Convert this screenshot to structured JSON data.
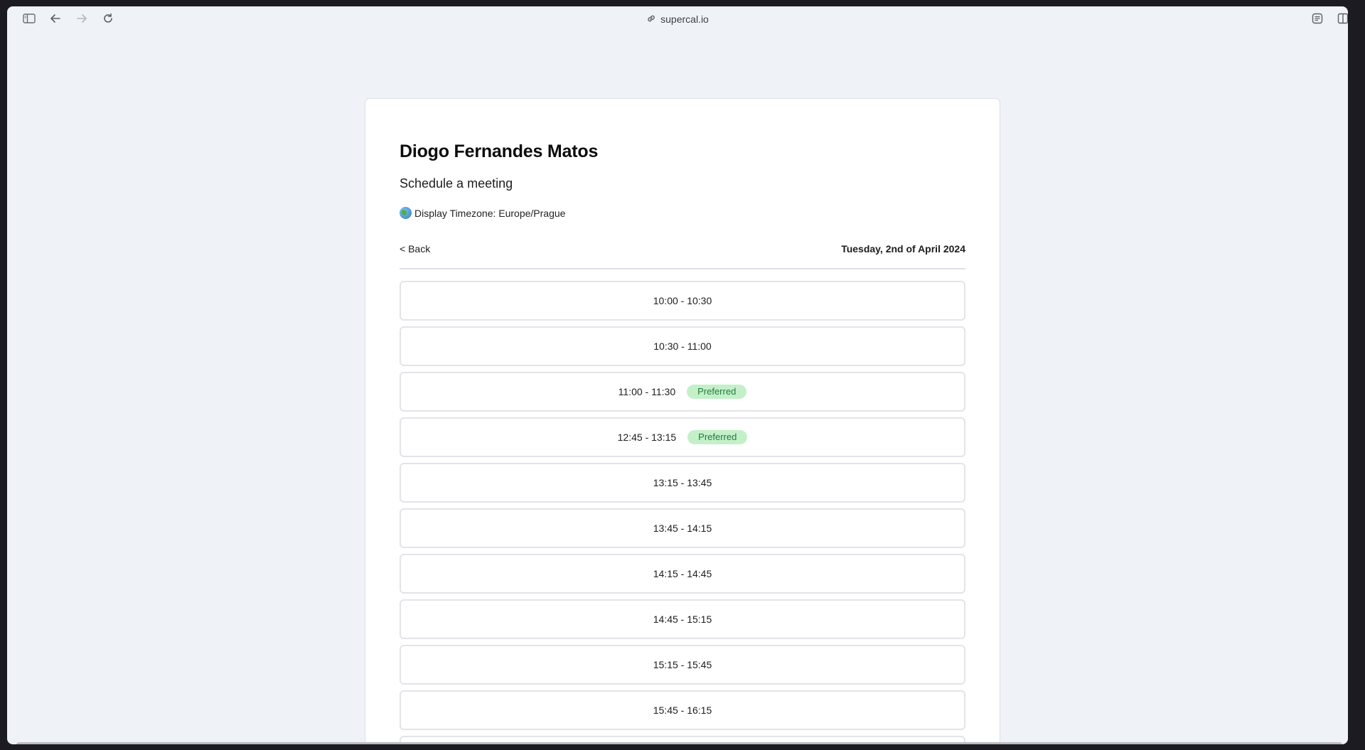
{
  "browser": {
    "url": "supercal.io",
    "icons": {
      "sidebar": "sidebar-toggle-icon",
      "back": "arrow-left-icon",
      "forward": "arrow-right-icon",
      "reload": "reload-icon",
      "link": "link-icon",
      "reader": "reader-mode-icon",
      "split": "split-view-icon"
    }
  },
  "page": {
    "name": "Diogo Fernandes Matos",
    "subtitle": "Schedule a meeting",
    "timezone_label": "Display Timezone: Europe/Prague",
    "back_label": "< Back",
    "date": "Tuesday, 2nd of April 2024",
    "slots": [
      {
        "time": "10:00 - 10:30",
        "badge": ""
      },
      {
        "time": "10:30 - 11:00",
        "badge": ""
      },
      {
        "time": "11:00 - 11:30",
        "badge": "Preferred"
      },
      {
        "time": "12:45 - 13:15",
        "badge": "Preferred"
      },
      {
        "time": "13:15 - 13:45",
        "badge": ""
      },
      {
        "time": "13:45 - 14:15",
        "badge": ""
      },
      {
        "time": "14:15 - 14:45",
        "badge": ""
      },
      {
        "time": "14:45 - 15:15",
        "badge": ""
      },
      {
        "time": "15:15 - 15:45",
        "badge": ""
      },
      {
        "time": "15:45 - 16:15",
        "badge": ""
      }
    ]
  },
  "colors": {
    "window_bg": "#eff2f6",
    "badge_bg": "#c3f0c9",
    "badge_text": "#237a3a"
  }
}
